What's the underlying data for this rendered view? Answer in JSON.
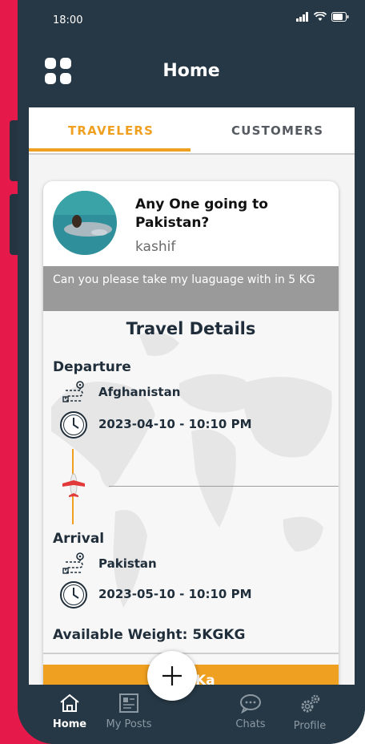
{
  "status_bar": {
    "time": "18:00",
    "signal_icon": "signal-icon",
    "wifi_icon": "wifi-icon",
    "battery_icon": "battery-icon"
  },
  "app_bar": {
    "title": "Home",
    "menu_icon": "grid-menu-icon"
  },
  "tabs": [
    {
      "label": "TRAVELERS",
      "active": true
    },
    {
      "label": "CUSTOMERS",
      "active": false
    }
  ],
  "post": {
    "title": "Any One going to Pakistan?",
    "username": "kashif",
    "message": "Can you please take my luaguage with in 5 KG",
    "details_title": "Travel Details",
    "departure": {
      "label": "Departure",
      "location": "Afghanistan",
      "datetime": "2023-04-10 - 10:10 PM"
    },
    "arrival": {
      "label": "Arrival",
      "location": "Pakistan",
      "datetime": "2023-05-10 - 10:10 PM"
    },
    "weight_label": "Available Weight:",
    "weight_value": "5KGKG",
    "partial_button_text": "tac  Ka"
  },
  "fab": {
    "icon": "plus-icon"
  },
  "bottom_nav": [
    {
      "label": "Home",
      "icon": "home-icon",
      "active": true
    },
    {
      "label": "My Posts",
      "icon": "posts-icon",
      "active": false
    },
    {
      "label": "Chats",
      "icon": "chat-icon",
      "active": false
    },
    {
      "label": "Profile",
      "icon": "gears-icon",
      "active": false
    }
  ],
  "colors": {
    "brand_red": "#e5194a",
    "app_dark": "#263845",
    "accent_orange": "#f0a020",
    "message_gray": "#9a9a9a"
  }
}
